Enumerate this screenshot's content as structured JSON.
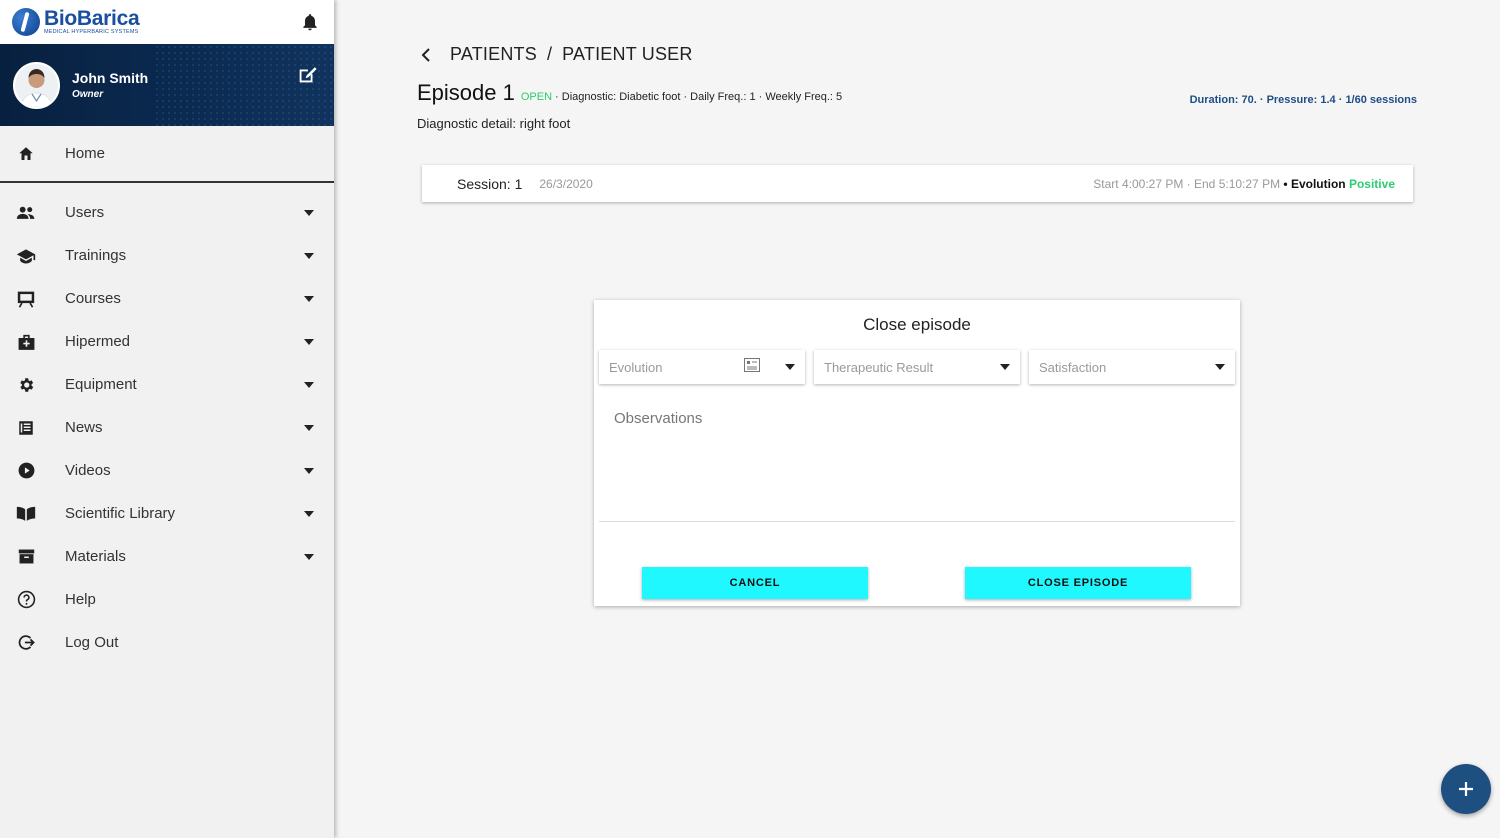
{
  "brand": {
    "name": "BioBarica",
    "tagline": "MEDICAL HYPERBARIC SYSTEMS"
  },
  "user": {
    "name": "John Smith",
    "role": "Owner"
  },
  "nav": {
    "home": "Home",
    "items": [
      {
        "label": "Users",
        "icon": "users-icon"
      },
      {
        "label": "Trainings",
        "icon": "graduation-cap-icon"
      },
      {
        "label": "Courses",
        "icon": "easel-icon"
      },
      {
        "label": "Hipermed",
        "icon": "medical-kit-icon"
      },
      {
        "label": "Equipment",
        "icon": "gear-icon"
      },
      {
        "label": "News",
        "icon": "newspaper-icon"
      },
      {
        "label": "Videos",
        "icon": "play-circle-icon"
      },
      {
        "label": "Scientific Library",
        "icon": "open-book-icon"
      },
      {
        "label": "Materials",
        "icon": "archive-box-icon"
      }
    ],
    "help": "Help",
    "logout": "Log Out"
  },
  "breadcrumb": {
    "parent": "PATIENTS",
    "separator": "/",
    "current": "PATIENT USER"
  },
  "episode": {
    "title": "Episode 1",
    "status": "OPEN",
    "meta": "· Diagnostic: Diabetic foot · Daily Freq.: 1 · Weekly Freq.: 5",
    "summary": "Duration: 70. · Pressure: 1.4 · 1/60 sessions",
    "diagnostic_detail": "Diagnostic detail: right foot"
  },
  "session": {
    "label": "Session: 1",
    "date": "26/3/2020",
    "times": "Start 4:00:27 PM · End 5:10:27 PM",
    "bullet": " • ",
    "evolution_label": "Evolution",
    "evolution_value": "Positive"
  },
  "dialog": {
    "title": "Close episode",
    "evolution_placeholder": "Evolution",
    "therapeutic_placeholder": "Therapeutic Result",
    "satisfaction_placeholder": "Satisfaction",
    "observations_placeholder": "Observations",
    "cancel_label": "CANCEL",
    "close_label": "CLOSE EPISODE"
  },
  "colors": {
    "accent": "#1ff8ff",
    "positive": "#2ecc71",
    "brand": "#1a4fa0",
    "fab": "#1d4f80"
  }
}
